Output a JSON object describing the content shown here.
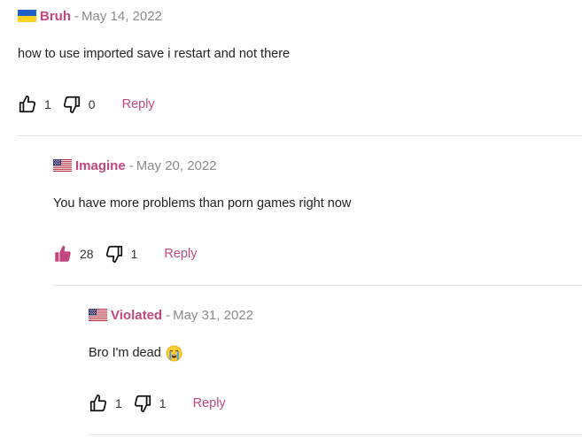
{
  "colors": {
    "accent": "#c2477f",
    "muted": "#8a8a8a",
    "text": "#222222",
    "divider": "#e4e4e4"
  },
  "comments": [
    {
      "flag": "ukraine-flag-icon",
      "author": "Bruh",
      "separator": "-",
      "date": "May 14, 2022",
      "text": "how to use imported save i restart and not there",
      "likes": "1",
      "dislikes": "0",
      "liked": false,
      "reply_label": "Reply"
    },
    {
      "flag": "usa-flag-icon",
      "author": "Imagine",
      "separator": "-",
      "date": "May 20, 2022",
      "text": "You have more problems than porn games right now",
      "likes": "28",
      "dislikes": "1",
      "liked": true,
      "reply_label": "Reply"
    },
    {
      "flag": "usa-flag-icon",
      "author": "Violated",
      "separator": "-",
      "date": "May 31, 2022",
      "text": "Bro I'm dead",
      "emoji": "crying-face-emoji",
      "likes": "1",
      "dislikes": "1",
      "liked": false,
      "reply_label": "Reply"
    }
  ]
}
